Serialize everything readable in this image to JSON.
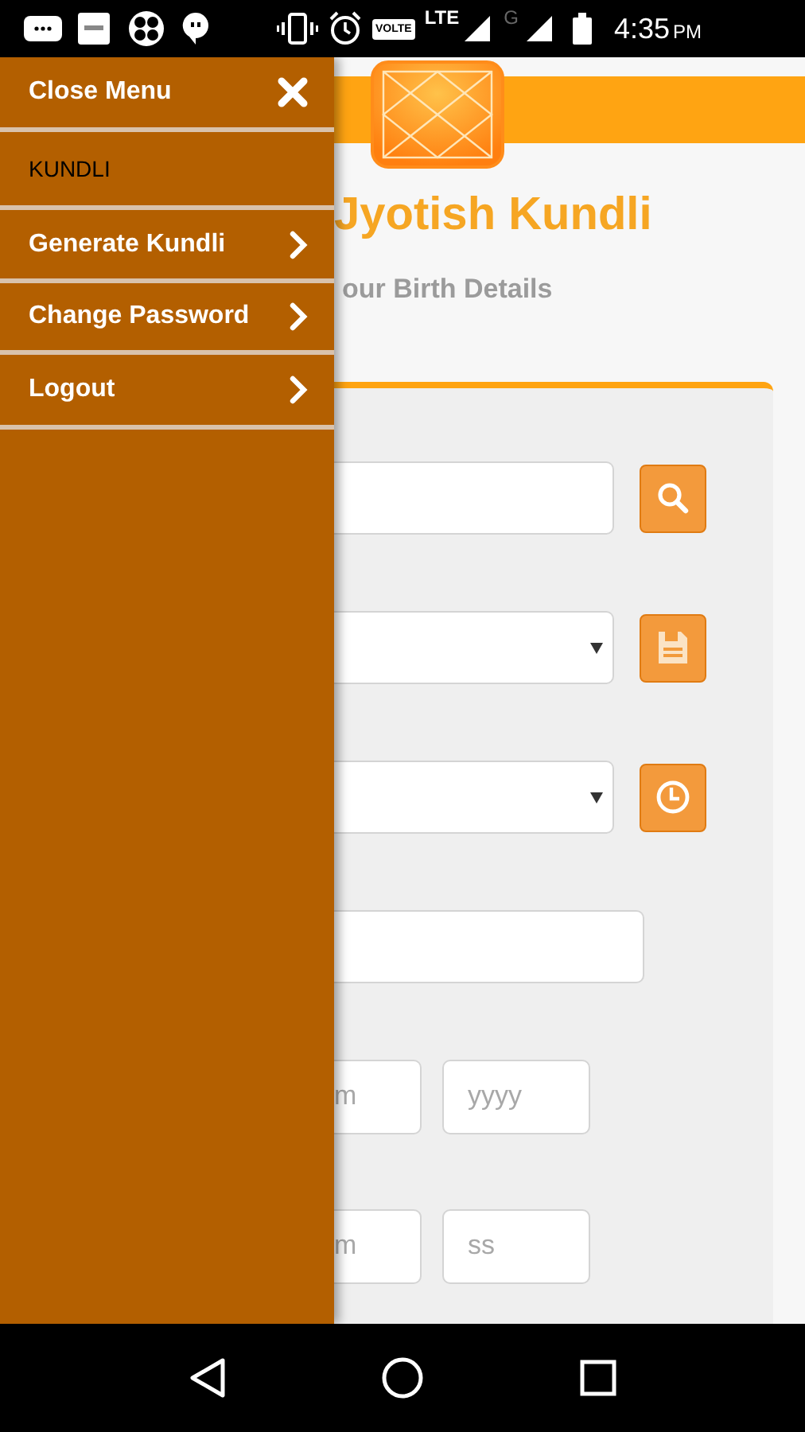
{
  "status_bar": {
    "volte": "VOLTE",
    "network": "LTE",
    "network_2": "G",
    "time": "4:35",
    "meridiem": "PM"
  },
  "drawer": {
    "items": [
      {
        "kind": "close",
        "label": "Close Menu"
      },
      {
        "kind": "heading",
        "label": "KUNDLI"
      },
      {
        "kind": "link",
        "label": "Generate Kundli"
      },
      {
        "kind": "link",
        "label": "Change Password"
      },
      {
        "kind": "link",
        "label": "Logout"
      }
    ]
  },
  "page": {
    "title": "Jyotish Kundli",
    "subtitle": "our Birth Details",
    "form_rows": [
      {
        "kind": "input",
        "button": {
          "kind": "search"
        }
      },
      {
        "kind": "select",
        "button": {
          "kind": "save"
        }
      },
      {
        "kind": "select",
        "button": {
          "kind": "clock"
        }
      },
      {
        "kind": "input"
      },
      {
        "kind": "pair",
        "placeholders": [
          "m",
          "yyyy"
        ]
      },
      {
        "kind": "pair",
        "placeholders": [
          "m",
          "ss"
        ]
      }
    ]
  }
}
